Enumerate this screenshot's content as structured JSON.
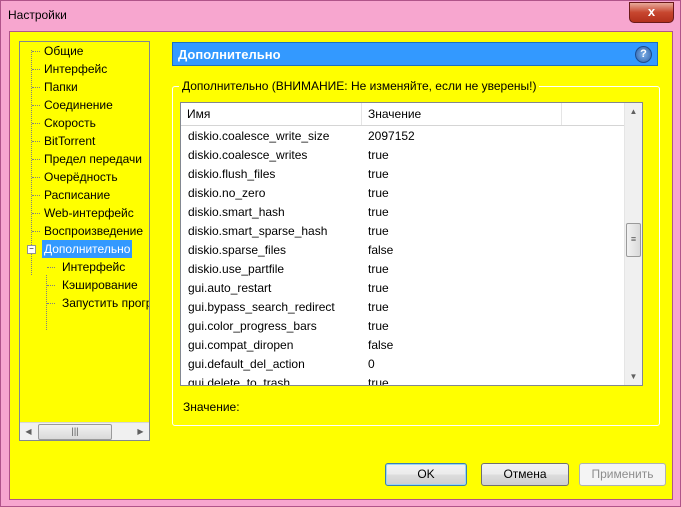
{
  "window": {
    "title": "Настройки",
    "close_label": "x"
  },
  "tree": {
    "items": [
      "Общие",
      "Интерфейс",
      "Папки",
      "Соединение",
      "Скорость",
      "BitTorrent",
      "Предел передачи",
      "Очерёдность",
      "Расписание",
      "Web-интерфейс",
      "Воспроизведение",
      "Дополнительно"
    ],
    "selected": "Дополнительно",
    "expander": "−",
    "children": [
      "Интерфейс",
      "Кэширование",
      "Запустить прогр"
    ],
    "scroll_thumb": "|||"
  },
  "panel": {
    "title": "Дополнительно",
    "help": "?",
    "group_label": "Дополнительно (ВНИМАНИЕ: Не изменяйте, если не уверены!)",
    "columns": [
      "Имя",
      "Значение"
    ],
    "rows": [
      {
        "name": "diskio.coalesce_write_size",
        "value": "2097152"
      },
      {
        "name": "diskio.coalesce_writes",
        "value": "true"
      },
      {
        "name": "diskio.flush_files",
        "value": "true"
      },
      {
        "name": "diskio.no_zero",
        "value": "true"
      },
      {
        "name": "diskio.smart_hash",
        "value": "true"
      },
      {
        "name": "diskio.smart_sparse_hash",
        "value": "true"
      },
      {
        "name": "diskio.sparse_files",
        "value": "false"
      },
      {
        "name": "diskio.use_partfile",
        "value": "true"
      },
      {
        "name": "gui.auto_restart",
        "value": "true"
      },
      {
        "name": "gui.bypass_search_redirect",
        "value": "true"
      },
      {
        "name": "gui.color_progress_bars",
        "value": "true"
      },
      {
        "name": "gui.compat_diropen",
        "value": "false"
      },
      {
        "name": "gui.default_del_action",
        "value": "0"
      },
      {
        "name": "gui.delete_to_trash",
        "value": "true"
      }
    ],
    "value_label": "Значение:",
    "scroll_thumb": "≡"
  },
  "buttons": {
    "ok": "OK",
    "cancel": "Отмена",
    "apply": "Применить"
  },
  "colors": {
    "background": "#ffff00",
    "selection": "#3399ff",
    "window_frame": "#f7a6cf"
  }
}
